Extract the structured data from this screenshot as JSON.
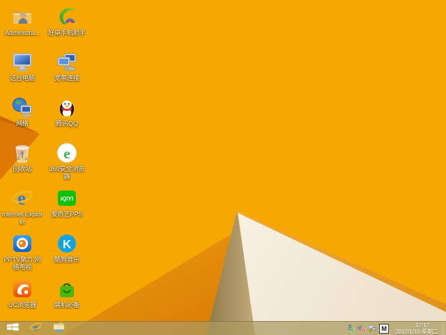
{
  "wallpaper": {
    "colors": {
      "base": "#F5A702",
      "dark_region_start": "#EF9B13",
      "dark_region_end": "#DB7E04",
      "wedge": "#DE7906",
      "wedge_edge": "#C96A03",
      "shadow_band_start": "#8F7947",
      "shadow_band_end": "#C4AC7C",
      "white_start": "#F7F1E2",
      "white_end": "#ECE0CA",
      "fold_strip_start": "#F0AA3A",
      "fold_strip_end": "#DE921B"
    }
  },
  "desktop": {
    "icons": [
      {
        "label": "Administra...",
        "icon": "user-folder-icon"
      },
      {
        "label": "好卓手机助手",
        "icon": "haozhuo-assistant-icon"
      },
      {
        "label": "这台电脑",
        "icon": "this-pc-icon"
      },
      {
        "label": "宽带连接",
        "icon": "broadband-connection-icon"
      },
      {
        "label": "网络",
        "icon": "network-globe-icon"
      },
      {
        "label": "腾讯QQ",
        "icon": "tencent-qq-icon"
      },
      {
        "label": "回收站",
        "icon": "recycle-bin-icon"
      },
      {
        "label": "360安全浏览器",
        "icon": "360-browser-icon"
      },
      {
        "label": "Internet Explorer",
        "icon": "internet-explorer-icon"
      },
      {
        "label": "爱奇艺PPS",
        "icon": "iqiyi-pps-icon",
        "icon_text": "iQIYI"
      },
      {
        "label": "PPTV聚力 网络电视",
        "icon": "pptv-icon"
      },
      {
        "label": "酷狗音乐",
        "icon": "kugou-music-icon",
        "icon_text": "K"
      },
      {
        "label": "UC浏览器",
        "icon": "uc-browser-icon"
      },
      {
        "label": "装机必备",
        "icon": "software-bundle-icon"
      }
    ]
  },
  "taskbar": {
    "buttons": [
      {
        "icon": "windows-start-icon"
      },
      {
        "icon": "internet-explorer-icon"
      },
      {
        "icon": "file-explorer-icon"
      }
    ],
    "tray": {
      "icons": [
        {
          "name": "usb-safely-remove-icon"
        },
        {
          "name": "volume-muted-icon"
        },
        {
          "name": "network-warning-icon"
        }
      ],
      "ime_label": "M"
    },
    "clock": {
      "time": "17:17",
      "date": "2017/1/10 星期二"
    }
  }
}
